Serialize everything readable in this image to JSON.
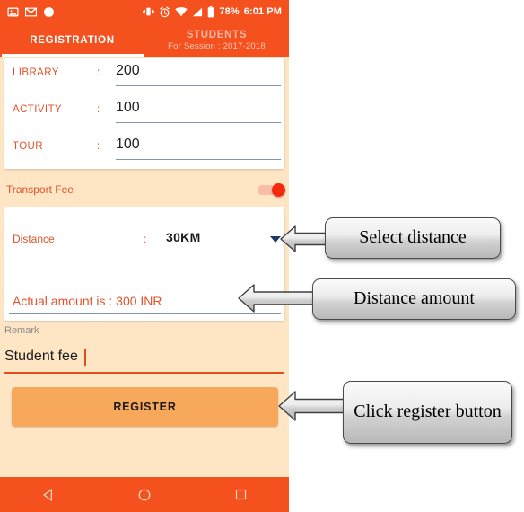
{
  "status_bar": {
    "icons": [
      "image-icon",
      "gmail-icon",
      "circle-icon",
      "vibrate-icon",
      "alarm-clock-icon",
      "wifi-icon",
      "signal-icon",
      "battery-icon"
    ],
    "battery_percent": "78%",
    "time": "6:01 PM"
  },
  "tabs": [
    {
      "label": "REGISTRATION",
      "sub": "",
      "active": true
    },
    {
      "label": "STUDENTS",
      "sub": "For Session : 2017-2018",
      "active": false
    }
  ],
  "fee_fields": [
    {
      "label": "LIBRARY",
      "separator": ":",
      "value": "200"
    },
    {
      "label": "ACTIVITY",
      "separator": ":",
      "value": "100"
    },
    {
      "label": "TOUR",
      "separator": ":",
      "value": "100"
    }
  ],
  "transport": {
    "label": "Transport Fee",
    "toggle_on": true
  },
  "distance": {
    "label": "Distance",
    "separator": ":",
    "value": "30KM",
    "options": [
      "30KM"
    ],
    "actual_amount": "Actual amount is : 300 INR"
  },
  "remark": {
    "label": "Remark",
    "value": "Student fee",
    "placeholder": "Remark"
  },
  "register": {
    "label": "REGISTER"
  },
  "nav_bar": {
    "back": "back-triangle-icon",
    "home": "home-circle-icon",
    "recents": "recents-square-icon"
  },
  "callouts": [
    {
      "text": "Select distance"
    },
    {
      "text": "Distance  amount"
    },
    {
      "text": "Click register button"
    }
  ],
  "colors": {
    "primary_orange": "#F4511E",
    "background_peach": "#FEE5C3",
    "accent_text": "#E0522B",
    "button_orange": "#F8A85A",
    "toggle_thumb": "#F4290D",
    "underline_blue": "#8194A8",
    "caret_navy": "#1F3864"
  }
}
